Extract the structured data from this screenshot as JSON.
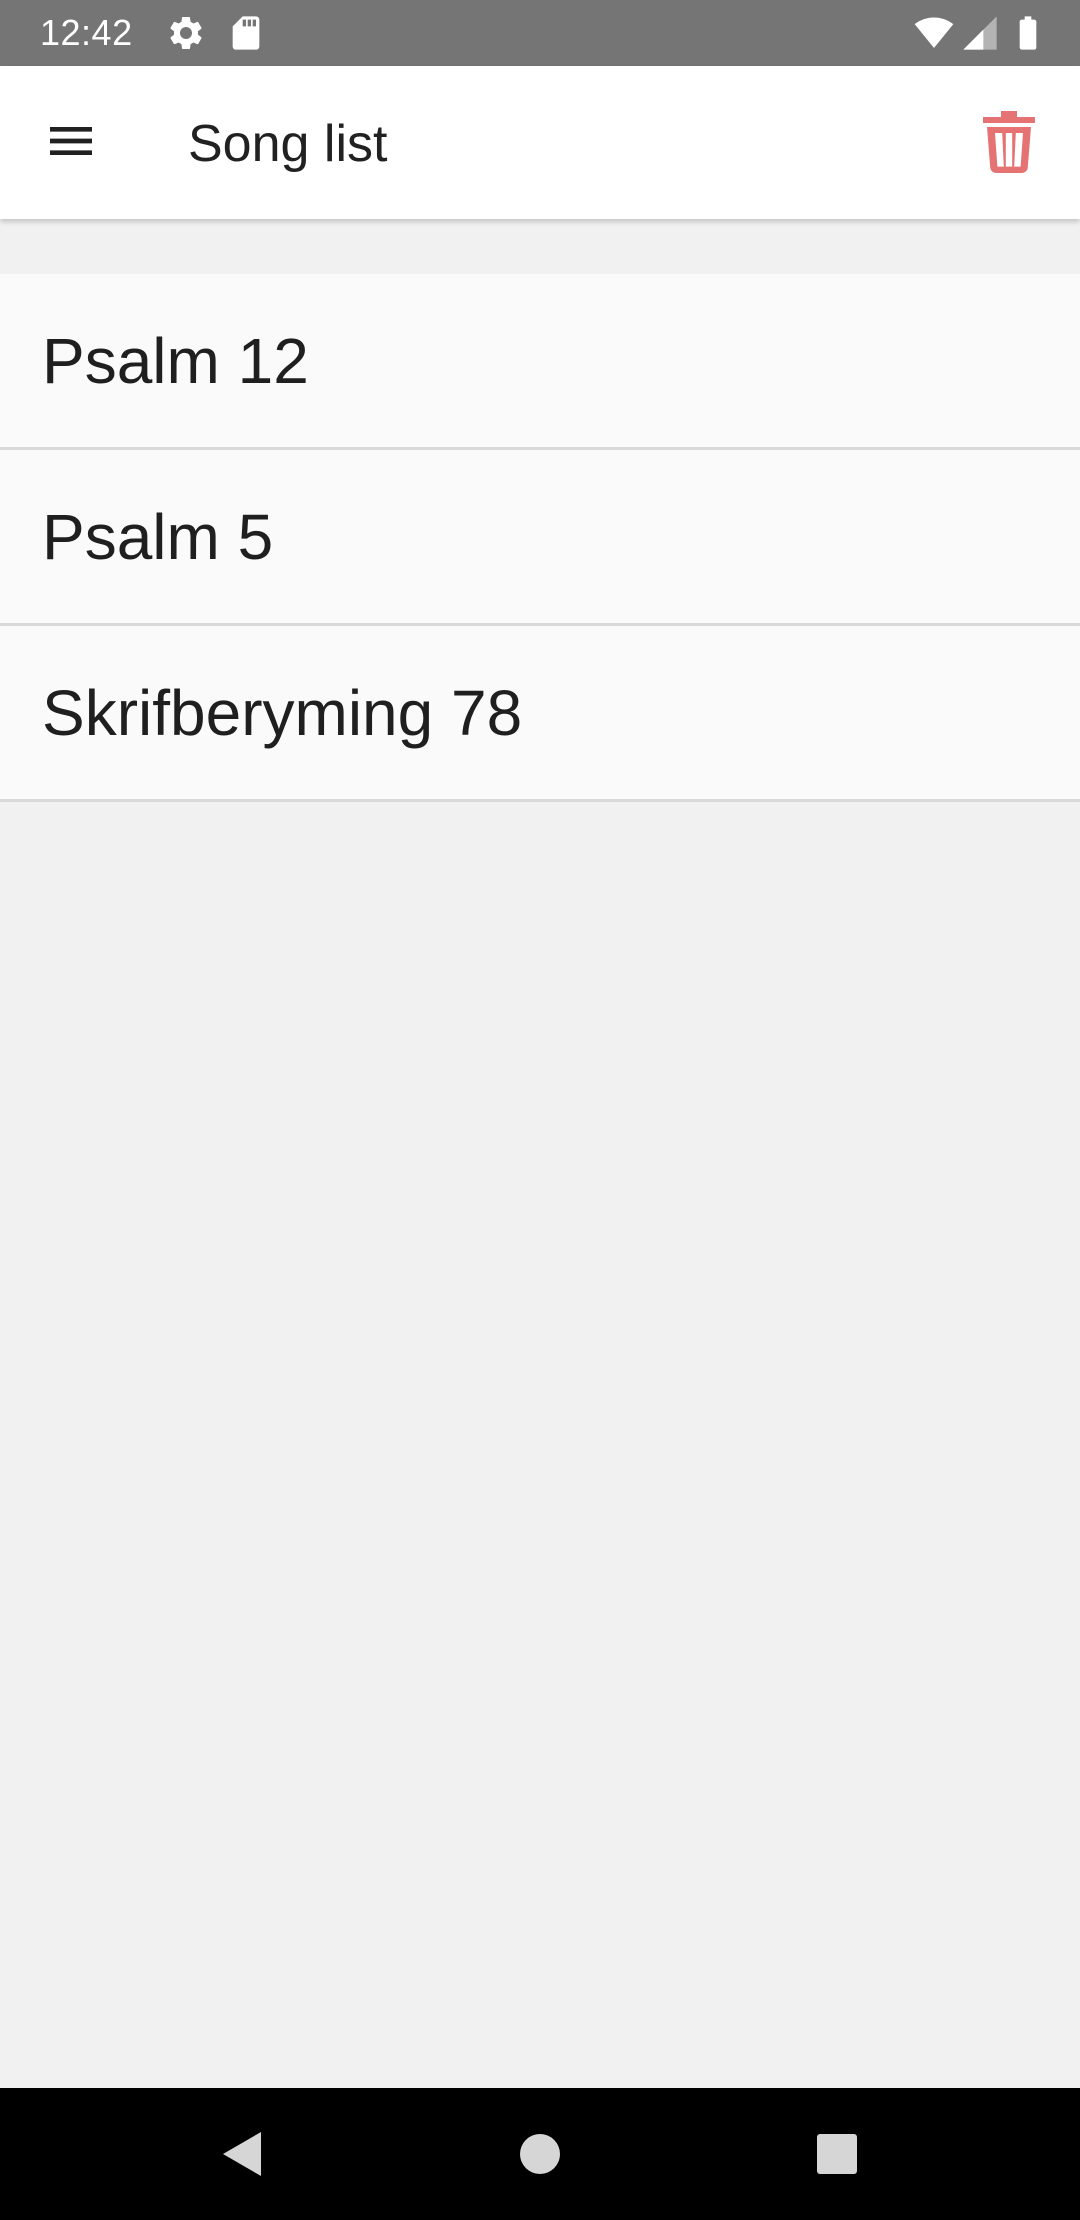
{
  "status_bar": {
    "time": "12:42",
    "icons": [
      "settings-icon",
      "sd-card-icon",
      "wifi-icon",
      "cell-signal-icon",
      "battery-icon"
    ]
  },
  "app_bar": {
    "title": "Song list",
    "menu_icon": "hamburger-menu-icon",
    "action_icon": "trash-icon",
    "action_color": "#e57373"
  },
  "songs": [
    {
      "label": "Psalm 12"
    },
    {
      "label": "Psalm 5"
    },
    {
      "label": "Skrifberyming 78"
    }
  ],
  "nav_bar": {
    "icons": [
      "back-icon",
      "home-icon",
      "recents-icon"
    ]
  },
  "colors": {
    "status_bar": "#757575",
    "background": "#f1f1f1",
    "list_item": "#fafafa",
    "divider": "#d9d9d9",
    "nav_bar": "#000000"
  }
}
